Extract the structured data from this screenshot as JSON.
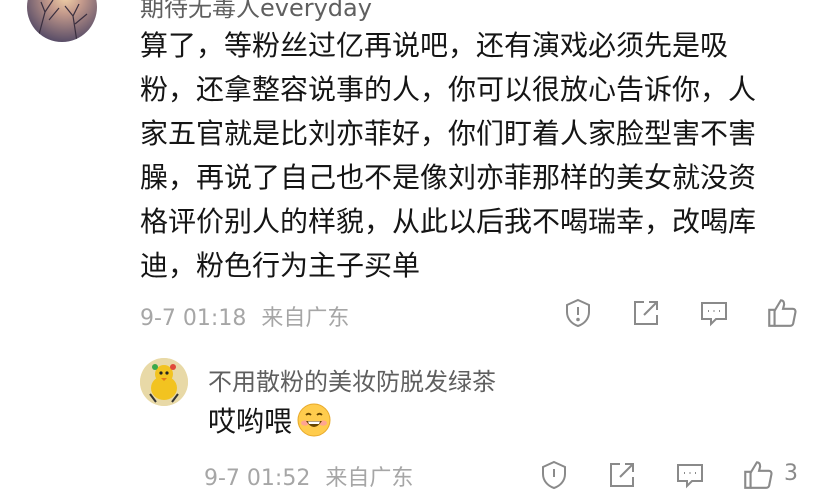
{
  "comments": [
    {
      "username": "期待无毒人everyday",
      "lines": [
        "算了，等粉丝过亿再说吧，还有演戏必须先是吸",
        "粉，还拿整容说事的人，你可以很放心告诉你，人",
        "家五官就是比刘亦菲好，你们盯着人家脸型害不害",
        "臊，再说了自己也不是像刘亦菲那样的美女就没资",
        "格评价别人的样貌，从此以后我不喝瑞幸，改喝库",
        "迪，粉色行为主子买单"
      ],
      "time": "9-7 01:18",
      "location": "来自广东",
      "icons": [
        "report-icon",
        "share-icon",
        "reply-icon",
        "like-icon"
      ]
    },
    {
      "username": "不用散粉的美妆防脱发绿茶",
      "text": "哎哟喂",
      "emoji": "grin-emoji",
      "time": "9-7 01:52",
      "location": "来自广东",
      "like_count": "3",
      "icons": [
        "report-icon",
        "share-icon",
        "reply-icon",
        "like-icon"
      ]
    }
  ],
  "colors": {
    "username": "#5f5f5f",
    "meta": "#a6a6a6",
    "icon": "#8a8a8a"
  }
}
